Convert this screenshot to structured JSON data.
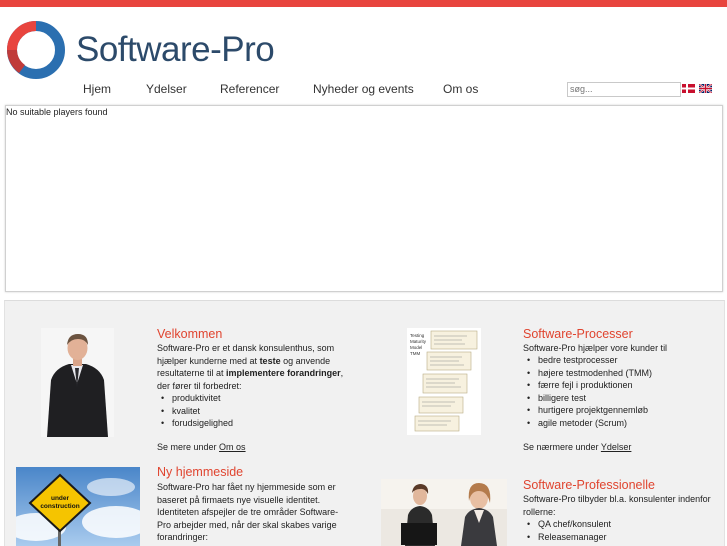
{
  "brand": {
    "name": "Software-Pro"
  },
  "nav": [
    "Hjem",
    "Ydelser",
    "Referencer",
    "Nyheder og events",
    "Om os"
  ],
  "search": {
    "placeholder": "søg..."
  },
  "player": {
    "message": "No suitable players found"
  },
  "velkommen": {
    "title": "Velkommen",
    "p1": "Software-Pro er et dansk konsulenthus, som",
    "p2a": "hjælper kunderne med at ",
    "p2b": "teste",
    "p2c": " og anvende",
    "p3a": "resultaterne til at ",
    "p3b": "implementere forandringer",
    "p3c": ",",
    "p4": "der fører til forbedret:",
    "items": [
      "produktivitet",
      "kvalitet",
      "forudsigelighed"
    ],
    "more_prefix": "Se mere under ",
    "more_link": "Om os"
  },
  "processer": {
    "title": "Software-Processer",
    "intro": "Software-Pro hjælper vore kunder til",
    "items": [
      "bedre testprocesser",
      "højere testmodenhed (TMM)",
      "færre fejl i produktionen",
      "billigere test",
      "hurtigere projektgennemløb",
      "agile metoder (Scrum)"
    ],
    "more_prefix": "Se nærmere under ",
    "more_link": "Ydelser"
  },
  "hjemmeside": {
    "title": "Ny hjemmeside",
    "lines": [
      "Software-Pro har fået ny hjemmeside som er",
      "baseret på firmaets nye visuelle identitet.",
      "Identiteten afspejler de tre områder Software-",
      "Pro arbejder med, når der skal skabes varige",
      "forandringer:"
    ],
    "sign": [
      "under",
      "construction"
    ]
  },
  "professionelle": {
    "title": "Software-Professionelle",
    "lines": [
      "Software-Pro tilbyder bl.a. konsulenter indenfor",
      "rollerne:"
    ],
    "items": [
      "QA chef/konsulent",
      "Releasemanager"
    ]
  },
  "tmm_diagram": [
    "Testing",
    "Maturity",
    "Model",
    "TMM"
  ],
  "colors": {
    "accent": "#e8443e",
    "title": "#e0442f",
    "brand_text": "#2c4a6a",
    "logo_blue": "#2b6fb0"
  }
}
